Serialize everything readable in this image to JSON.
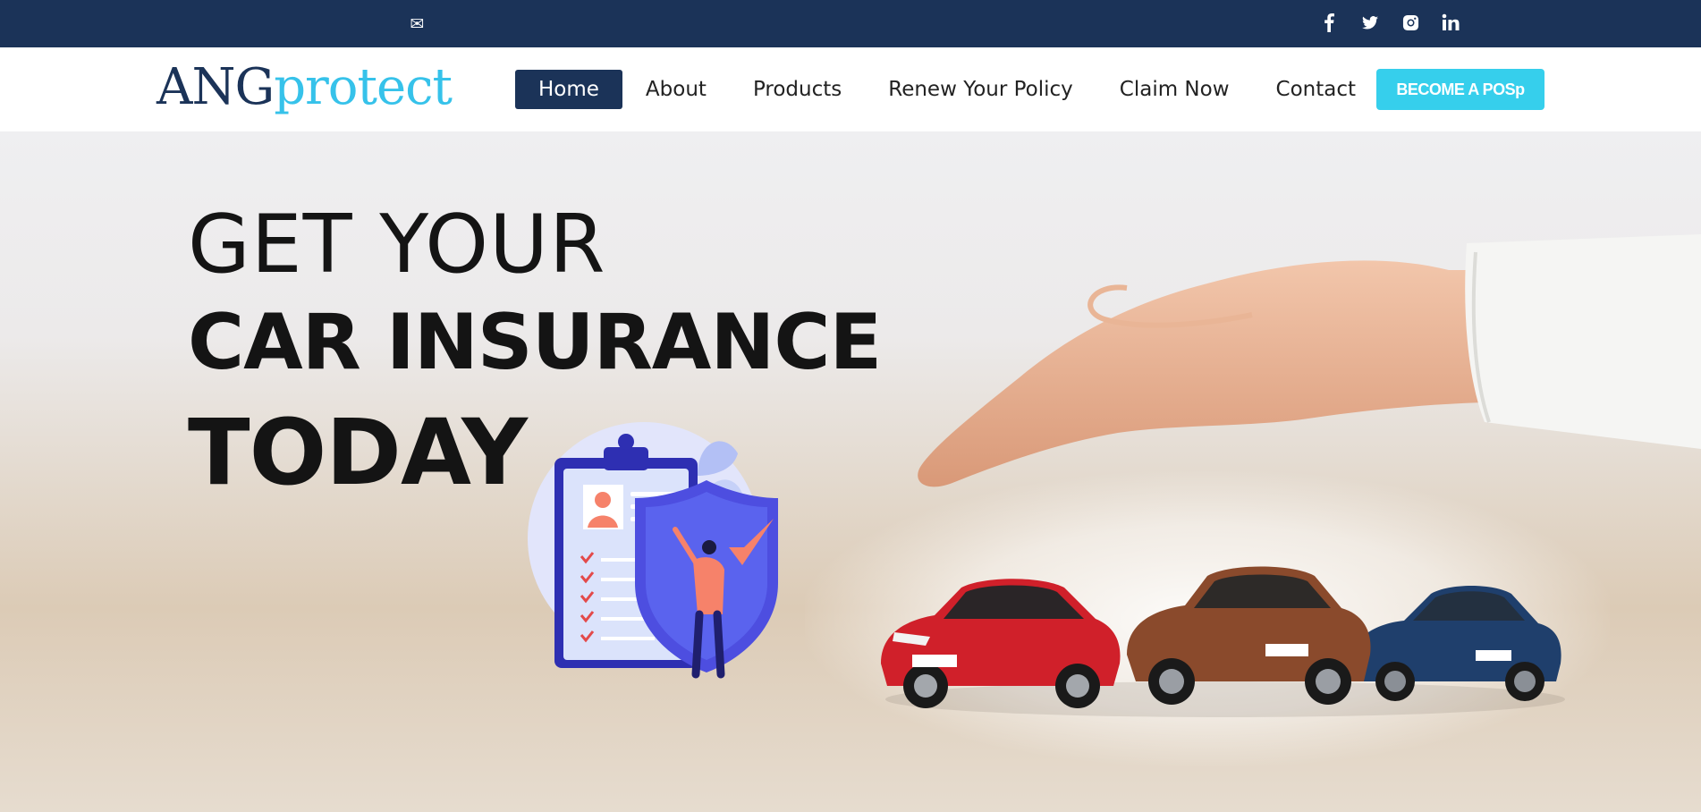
{
  "topbar": {
    "icons": [
      "mail-icon",
      "facebook-icon",
      "twitter-icon",
      "instagram-icon",
      "linkedin-icon"
    ]
  },
  "logo": {
    "part1": "ANG",
    "part2": "protect"
  },
  "nav": {
    "items": [
      {
        "label": "Home",
        "active": true
      },
      {
        "label": "About",
        "active": false
      },
      {
        "label": "Products",
        "active": false
      },
      {
        "label": "Renew Your Policy",
        "active": false
      },
      {
        "label": "Claim Now",
        "active": false
      },
      {
        "label": "Contact",
        "active": false
      }
    ],
    "cta_label": "BECOME A POSp"
  },
  "hero": {
    "line1": "GET YOUR",
    "line2": "CAR INSURANCE",
    "line3": "TODAY"
  },
  "colors": {
    "navy": "#1b3358",
    "accent": "#36cfec",
    "heading": "#141414"
  }
}
